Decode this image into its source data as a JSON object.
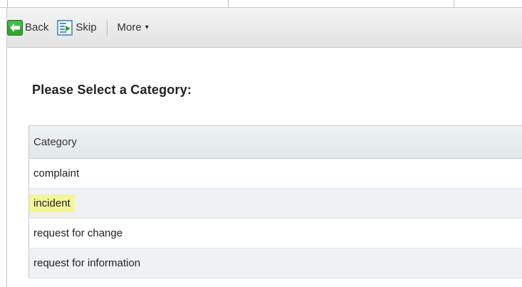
{
  "toolbar": {
    "back_label": "Back",
    "skip_label": "Skip",
    "more_label": "More",
    "more_caret": "▾"
  },
  "heading": "Please Select a Category:",
  "table": {
    "column_header": "Category",
    "rows": [
      {
        "label": "complaint",
        "highlighted": false
      },
      {
        "label": "incident",
        "highlighted": true
      },
      {
        "label": "request for change",
        "highlighted": false
      },
      {
        "label": "request for information",
        "highlighted": false
      }
    ]
  },
  "colors": {
    "back_icon": "#2e9e2e",
    "skip_icon": "#2a7fbf",
    "highlight": "#f4f49a",
    "row_alt": "#eef2f5"
  }
}
